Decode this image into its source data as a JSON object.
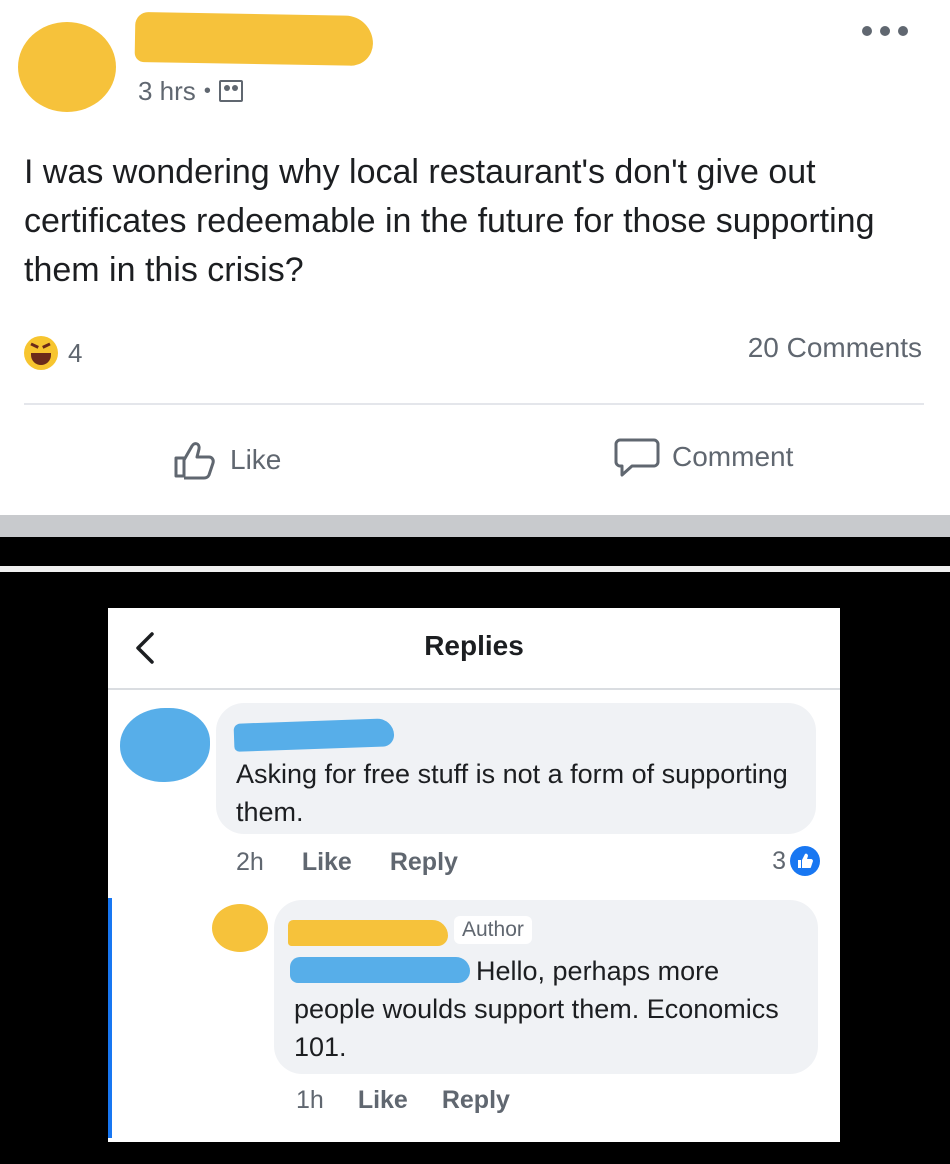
{
  "post": {
    "time": "3 hrs",
    "audience_icon": "friends-audience-icon",
    "text": "I was wondering why local restaurant's don't give out certificates redeemable in the future for those supporting them in this crisis?",
    "reaction_count": "4",
    "comments_count": "20 Comments",
    "like_label": "Like",
    "comment_label": "Comment"
  },
  "replies": {
    "title": "Replies",
    "comment": {
      "text": "Asking for free stuff is not a form of supporting them.",
      "time": "2h",
      "like_label": "Like",
      "reply_label": "Reply",
      "like_count": "3"
    },
    "reply": {
      "badge": "Author",
      "text": "Hello, perhaps more people woulds support them. Economics 101.",
      "time": "1h",
      "like_label": "Like",
      "reply_label": "Reply"
    }
  },
  "colors": {
    "redaction_yellow": "#f6c23b",
    "redaction_blue": "#57aee9",
    "facebook_blue": "#1877f2",
    "secondary_text": "#606770"
  }
}
